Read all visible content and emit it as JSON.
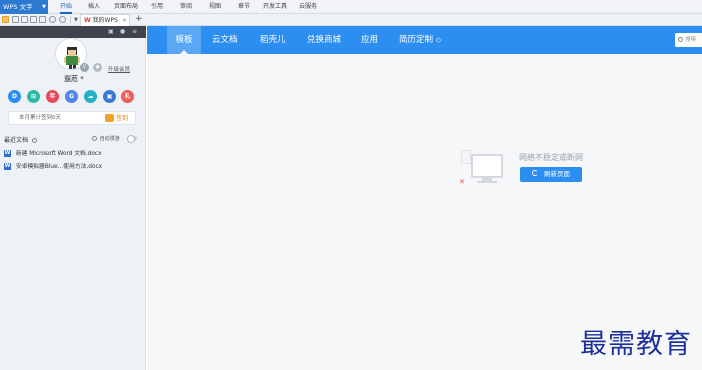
{
  "menubar": {
    "app_name": "WPS 文字",
    "items": [
      "开始",
      "插入",
      "页面布局",
      "引用",
      "审阅",
      "视图",
      "章节",
      "开发工具",
      "云服务"
    ],
    "active_index": 0
  },
  "tabs": {
    "doc_tab_label": "我的WPS",
    "doc_tab_logo": "W",
    "add_label": "+"
  },
  "user": {
    "name": "遛苊 *",
    "vip_link": "升级会员",
    "app_icons": [
      {
        "label": "D",
        "color": "#2d8ef1",
        "icon": "docer-icon"
      },
      {
        "label": "⊞",
        "color": "#2fb9a5",
        "icon": "apps-icon"
      },
      {
        "label": "年",
        "color": "#e8485a",
        "icon": "calendar-icon"
      },
      {
        "label": "G",
        "color": "#4f86e8",
        "icon": "g-icon"
      },
      {
        "label": "☁",
        "color": "#23b1c4",
        "icon": "cloud-icon"
      },
      {
        "label": "▣",
        "color": "#3a78d6",
        "icon": "disk-icon"
      },
      {
        "label": "礼",
        "color": "#ee5d55",
        "icon": "gift-icon"
      }
    ]
  },
  "checkin": {
    "text": "本月累计签到0天",
    "button": "签到"
  },
  "recent": {
    "title": "最近文档",
    "auto_roam": "自动漫游",
    "files": [
      "新建 Microsoft Word 文档.docx",
      "安卓模拟器Blue...使用方法.docx"
    ]
  },
  "nav": {
    "items": [
      "模板",
      "云文档",
      "稻壳儿",
      "兑换商城",
      "应用",
      "简历定制"
    ],
    "active_index": 0,
    "search_placeholder": "搜模"
  },
  "offline": {
    "message": "网络不稳定或断网",
    "refresh_button": "刷新页面"
  },
  "watermark": "最需教育"
}
